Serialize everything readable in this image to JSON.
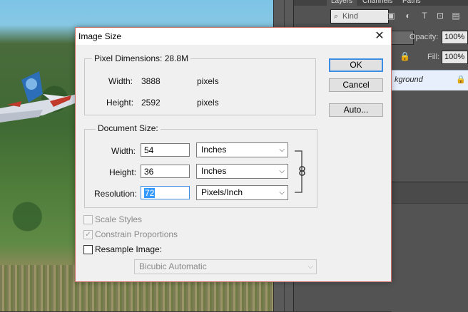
{
  "photoshop": {
    "tabs": [
      "Layers",
      "Channels",
      "Paths"
    ],
    "filter_kind": "Kind",
    "opacity_label": "Opacity:",
    "opacity_value": "100%",
    "fill_label": "Fill:",
    "fill_value": "100%",
    "layer_name": "kground"
  },
  "dialog": {
    "title": "Image Size",
    "pixel_dimensions": {
      "label": "Pixel Dimensions:",
      "value": "28.8M",
      "width_label": "Width:",
      "width_value": "3888",
      "width_unit": "pixels",
      "height_label": "Height:",
      "height_value": "2592",
      "height_unit": "pixels"
    },
    "document_size": {
      "label": "Document Size:",
      "width_label": "Width:",
      "width_value": "54",
      "width_unit": "Inches",
      "height_label": "Height:",
      "height_value": "36",
      "height_unit": "Inches",
      "resolution_label": "Resolution:",
      "resolution_value": "72",
      "resolution_unit": "Pixels/Inch"
    },
    "options": {
      "scale_styles": "Scale Styles",
      "constrain_proportions": "Constrain Proportions",
      "resample_image": "Resample Image:",
      "resample_method": "Bicubic Automatic"
    },
    "buttons": {
      "ok": "OK",
      "cancel": "Cancel",
      "auto": "Auto..."
    }
  }
}
